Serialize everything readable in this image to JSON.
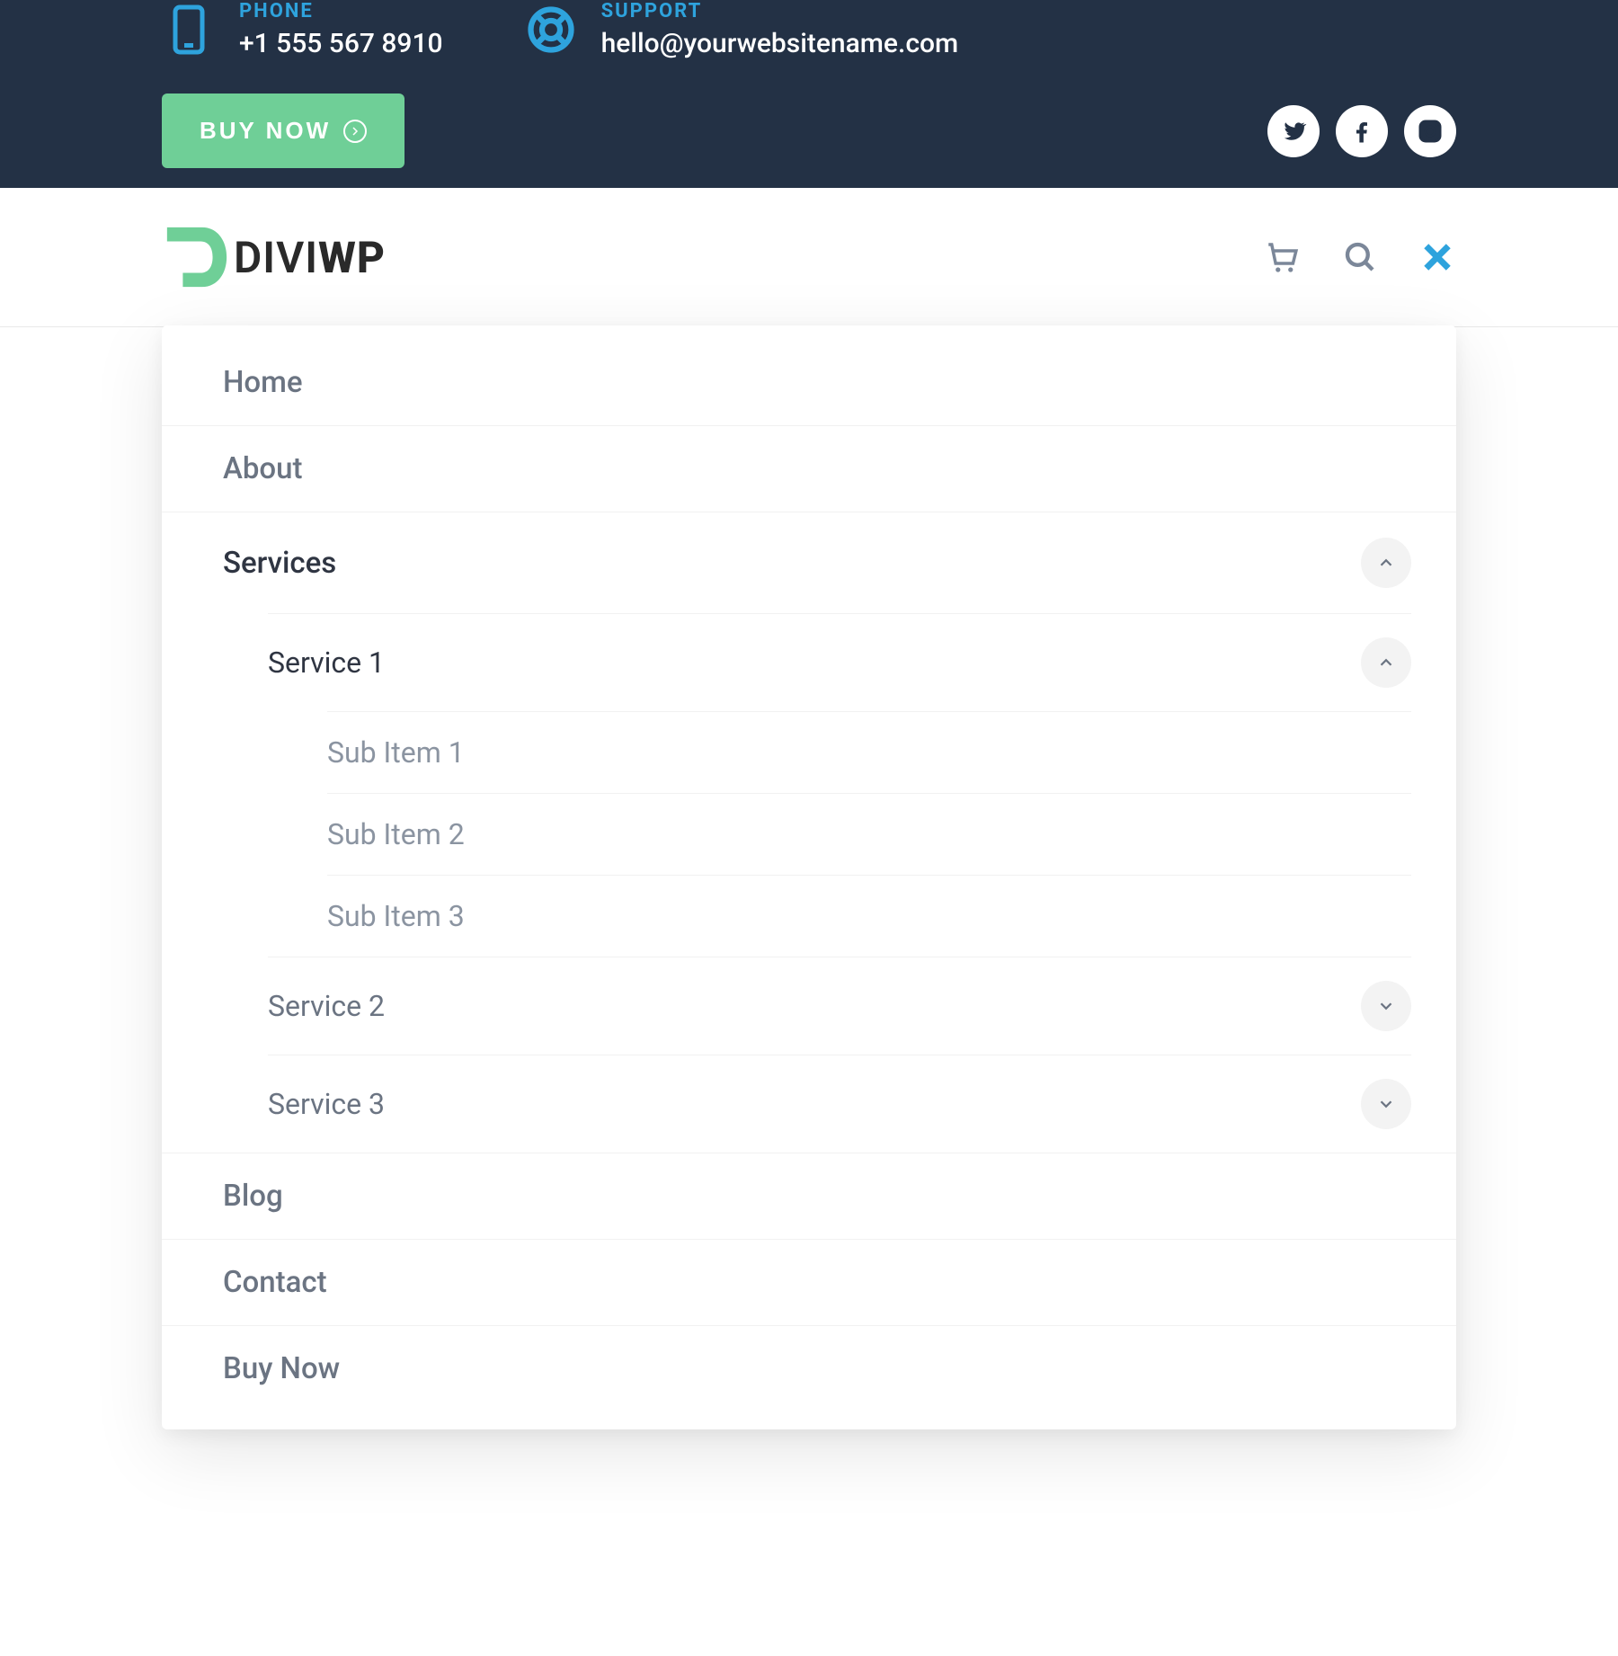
{
  "topbar": {
    "phone": {
      "label": "PHONE",
      "value": "+1 555 567 8910"
    },
    "support": {
      "label": "SUPPORT",
      "value": "hello@yourwebsitename.com"
    },
    "cta_label": "BUY NOW"
  },
  "socials": {
    "twitter": "twitter",
    "facebook": "facebook",
    "instagram": "instagram"
  },
  "logo": {
    "part1": "DIVI",
    "part2": "WP"
  },
  "menu": {
    "home": "Home",
    "about": "About",
    "services": {
      "label": "Services",
      "service1": {
        "label": "Service 1",
        "sub1": "Sub Item 1",
        "sub2": "Sub Item 2",
        "sub3": "Sub Item 3"
      },
      "service2": {
        "label": "Service 2"
      },
      "service3": {
        "label": "Service 3"
      }
    },
    "blog": "Blog",
    "contact": "Contact",
    "buynow": "Buy Now"
  }
}
